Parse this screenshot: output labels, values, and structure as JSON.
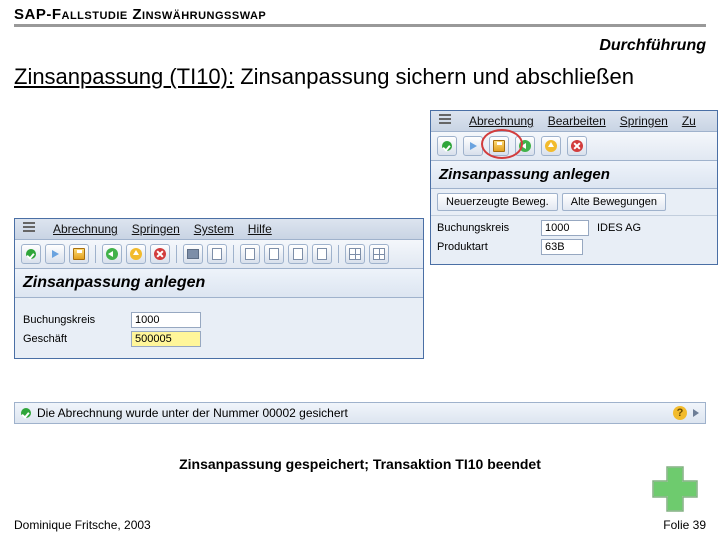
{
  "header": {
    "title": "SAP-Fallstudie Zinswährungsswap",
    "phase": "Durchführung"
  },
  "heading": {
    "prefix": "Zinsanpassung (TI10):",
    "rest": " Zinsanpassung sichern und abschließen"
  },
  "sap_right": {
    "menu": [
      "Abrechnung",
      "Bearbeiten",
      "Springen",
      "Zu"
    ],
    "subtitle": "Zinsanpassung anlegen",
    "buttons": [
      "Neuerzeugte Beweg.",
      "Alte Bewegungen"
    ],
    "rows": [
      {
        "label": "Buchungskreis",
        "value": "1000",
        "desc": "IDES AG"
      },
      {
        "label": "Produktart",
        "value": "63B",
        "desc": ""
      }
    ]
  },
  "sap_left": {
    "menu": [
      "Abrechnung",
      "Springen",
      "System",
      "Hilfe"
    ],
    "subtitle": "Zinsanpassung anlegen",
    "rows": [
      {
        "label": "Buchungskreis",
        "value": "1000"
      },
      {
        "label": "Geschäft",
        "value": "500005"
      }
    ]
  },
  "status": "Die Abrechnung wurde unter der Nummer 00002 gesichert",
  "caption": "Zinsanpassung gespeichert; Transaktion TI10 beendet",
  "footer": {
    "author": "Dominique Fritsche, 2003",
    "page": "Folie 39"
  }
}
